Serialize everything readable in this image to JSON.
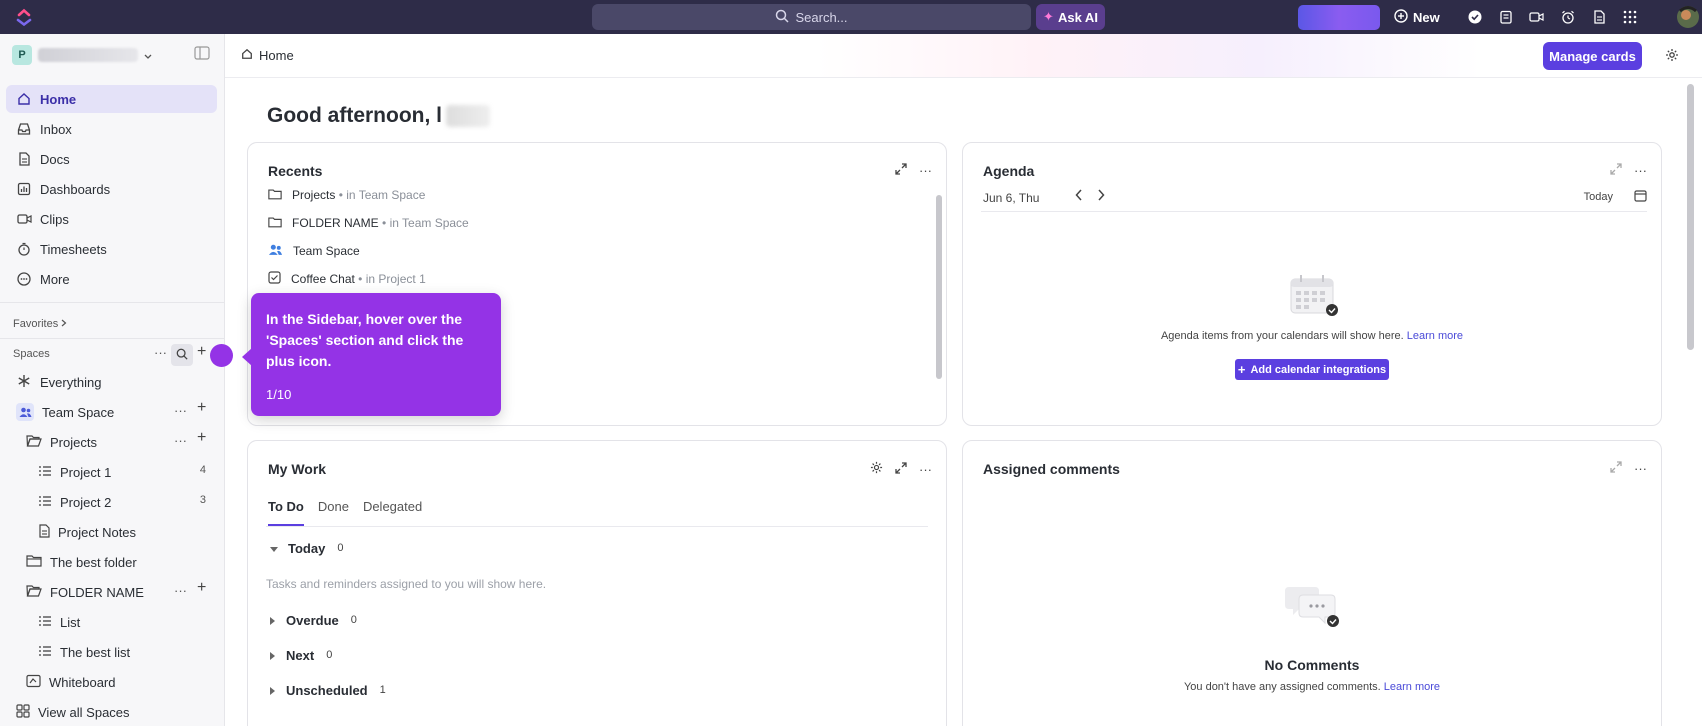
{
  "topbar": {
    "search_placeholder": "Search...",
    "ask_ai_label": "Ask AI",
    "new_label": "New",
    "icons": [
      "check-circle-icon",
      "notepad-icon",
      "video-icon",
      "alarm-icon",
      "doc-icon",
      "apps-grid-icon"
    ]
  },
  "sidebar": {
    "workspace_initial": "P",
    "nav": [
      {
        "label": "Home",
        "icon": "home-icon",
        "active": true
      },
      {
        "label": "Inbox",
        "icon": "inbox-icon"
      },
      {
        "label": "Docs",
        "icon": "docs-icon"
      },
      {
        "label": "Dashboards",
        "icon": "dashboards-icon"
      },
      {
        "label": "Clips",
        "icon": "clips-icon"
      },
      {
        "label": "Timesheets",
        "icon": "timesheets-icon"
      },
      {
        "label": "More",
        "icon": "more-icon"
      }
    ],
    "favorites_label": "Favorites",
    "spaces_label": "Spaces",
    "tree": [
      {
        "label": "Everything",
        "icon": "everything-icon"
      },
      {
        "label": "Team Space",
        "icon": "team-space-icon"
      },
      {
        "label": "Projects",
        "icon": "folder-open-icon"
      },
      {
        "label": "Project 1",
        "icon": "list-icon",
        "count": "4"
      },
      {
        "label": "Project 2",
        "icon": "list-icon",
        "count": "3"
      },
      {
        "label": "Project Notes",
        "icon": "doc-icon"
      },
      {
        "label": "The best folder",
        "icon": "folder-icon"
      },
      {
        "label": "FOLDER NAME",
        "icon": "folder-open-icon"
      },
      {
        "label": "List",
        "icon": "list-icon"
      },
      {
        "label": "The best list",
        "icon": "list-icon"
      },
      {
        "label": "Whiteboard",
        "icon": "whiteboard-icon"
      },
      {
        "label": "View all Spaces",
        "icon": "grid-icon"
      }
    ]
  },
  "header": {
    "breadcrumb": "Home",
    "manage_cards_label": "Manage cards"
  },
  "greeting": "Good afternoon, l",
  "recents": {
    "title": "Recents",
    "items": [
      {
        "name": "Projects",
        "location": "• in Team Space",
        "icon": "folder-icon"
      },
      {
        "name": "FOLDER NAME",
        "location": "• in Team Space",
        "icon": "folder-icon"
      },
      {
        "name": "Team Space",
        "location": "",
        "icon": "people-icon"
      },
      {
        "name": "Coffee Chat",
        "location": "• in Project 1",
        "icon": "task-icon"
      }
    ]
  },
  "agenda": {
    "title": "Agenda",
    "date": "Jun 6, Thu",
    "today_label": "Today",
    "empty_text": "Agenda items from your calendars will show here.",
    "learn_more": "Learn more",
    "add_integrations_label": "Add calendar integrations"
  },
  "my_work": {
    "title": "My Work",
    "tabs": [
      "To Do",
      "Done",
      "Delegated"
    ],
    "groups": [
      {
        "label": "Today",
        "count": "0",
        "expanded": true
      },
      {
        "label": "Overdue",
        "count": "0"
      },
      {
        "label": "Next",
        "count": "0"
      },
      {
        "label": "Unscheduled",
        "count": "1"
      }
    ],
    "empty_text": "Tasks and reminders assigned to you will show here."
  },
  "assigned_comments": {
    "title": "Assigned comments",
    "empty_title": "No Comments",
    "empty_text": "You don't have any assigned comments.",
    "learn_more": "Learn more"
  },
  "tooltip": {
    "text": "In the Sidebar, hover over the 'Spaces' section and click the plus icon.",
    "step": "1/10"
  },
  "colors": {
    "accent": "#5b3fe0",
    "tooltip": "#9433e6",
    "topbar": "#2e2c48"
  }
}
